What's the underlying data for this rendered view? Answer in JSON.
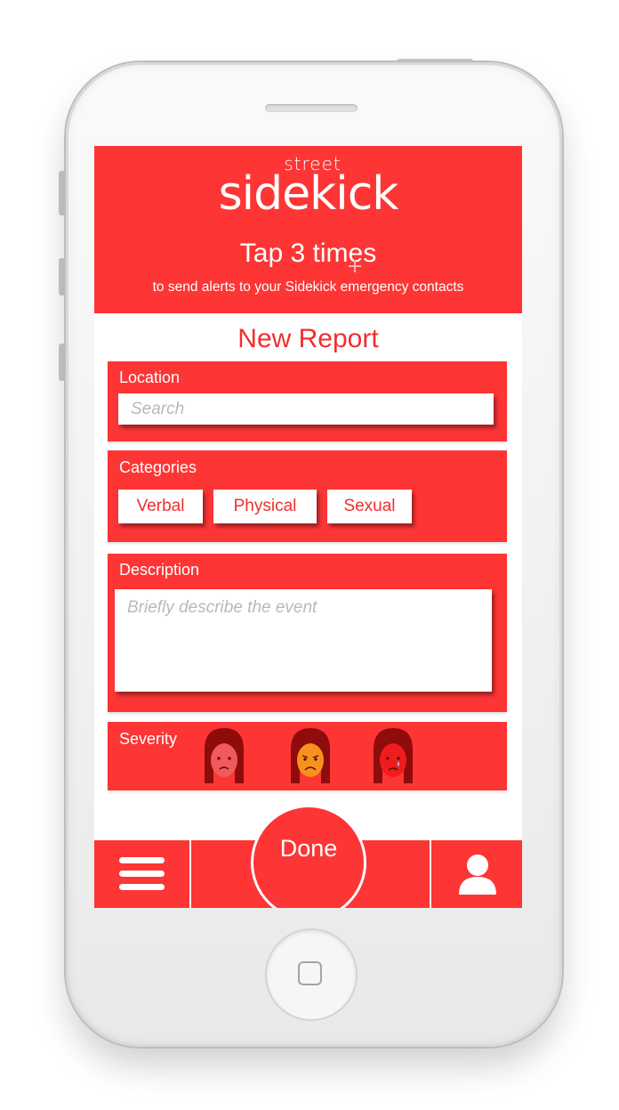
{
  "header": {
    "brand_small": "street",
    "brand": "sidekick",
    "tap_title": "Tap 3 times",
    "tap_subtitle": "to send alerts to your Sidekick emergency contacts"
  },
  "form": {
    "title": "New Report",
    "location": {
      "label": "Location",
      "placeholder": "Search"
    },
    "categories": {
      "label": "Categories",
      "options": [
        "Verbal",
        "Physical",
        "Sexual"
      ]
    },
    "description": {
      "label": "Description",
      "placeholder": "Briefly describe the event"
    },
    "severity": {
      "label": "Severity",
      "levels": [
        "sad-face-mild",
        "frowning-face-moderate",
        "crying-face-severe"
      ]
    }
  },
  "tabbar": {
    "done_label": "Done",
    "menu_icon": "hamburger-menu-icon",
    "profile_icon": "user-profile-icon"
  },
  "colors": {
    "accent": "#fd3535",
    "title_red": "#f12e2e",
    "face_mild": "#f05a5a",
    "face_moderate": "#f7921e",
    "face_severe": "#ee1c1c",
    "hair": "#8e0c0c"
  }
}
